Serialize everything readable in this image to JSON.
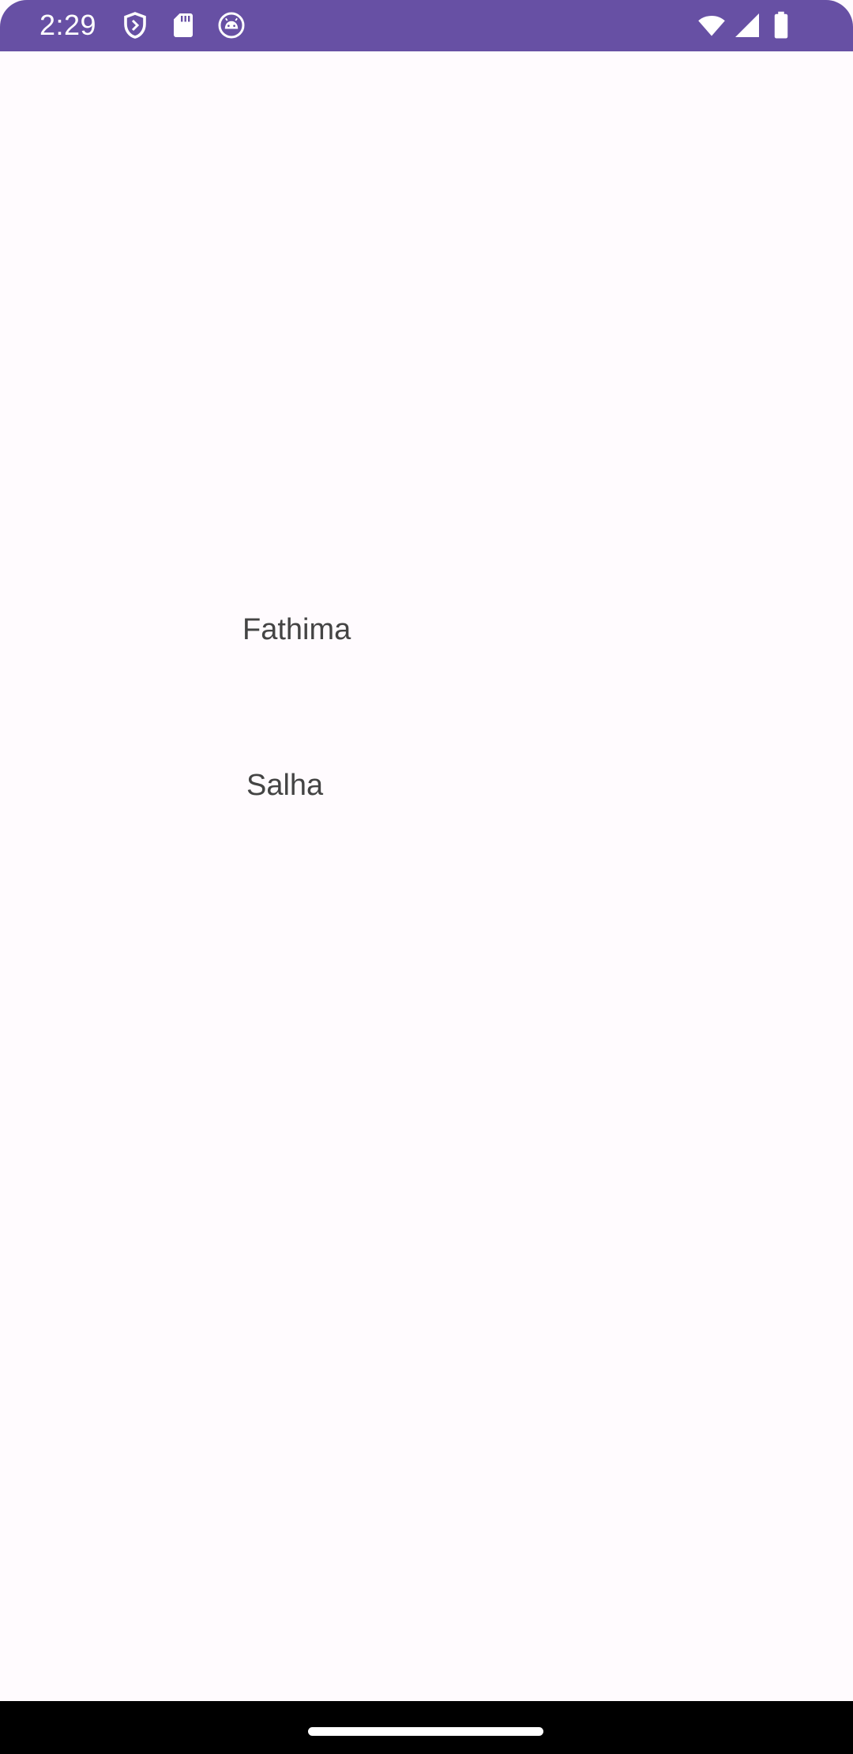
{
  "status_bar": {
    "time": "2:29",
    "color": "#6750A4",
    "left_icons": [
      "shield-icon",
      "sd-card-icon",
      "android-debug-icon"
    ],
    "right_icons": [
      "wifi-icon",
      "cell-signal-icon",
      "battery-icon"
    ]
  },
  "content": {
    "names": [
      "Fathima",
      "Salha"
    ]
  },
  "nav_bar": {
    "handle_icon": "home-handle"
  }
}
